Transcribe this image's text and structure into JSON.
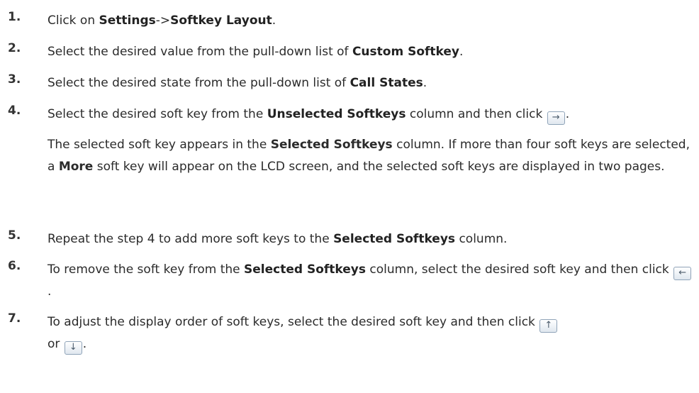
{
  "steps": [
    {
      "num": "1.",
      "parts": [
        "Click on ",
        "Settings",
        "->",
        "Softkey Layout",
        "."
      ]
    },
    {
      "num": "2.",
      "parts": [
        "Select the desired value from the pull-down list of ",
        "Custom Softkey",
        "."
      ]
    },
    {
      "num": "3.",
      "parts": [
        "Select the desired state from the pull-down list of ",
        "Call States",
        "."
      ]
    },
    {
      "num": "4.",
      "parts": [
        "Select the desired soft key from the ",
        "Unselected Softkeys",
        " column and then click ",
        "."
      ]
    },
    {
      "num": "5.",
      "parts": [
        "Repeat the step 4 to add more soft keys to the ",
        "Selected Softkeys",
        " column."
      ]
    },
    {
      "num": "6.",
      "parts": [
        "To remove the soft key from the ",
        "Selected Softkeys",
        " column, select the desired soft key and then click ",
        "."
      ]
    },
    {
      "num": "7.",
      "parts": [
        "To adjust the display order of soft keys, select the desired soft key and then click ",
        "or ",
        "."
      ]
    }
  ],
  "step4_note": [
    "The selected soft key appears in the ",
    "Selected Softkeys",
    " column. If more than four soft keys are selected, a ",
    "More",
    " soft key will appear on the LCD screen, and the selected soft keys are displayed in two pages."
  ],
  "icons": {
    "move_right": "→",
    "move_left": "←",
    "move_up": "↑",
    "move_down": "↓"
  }
}
